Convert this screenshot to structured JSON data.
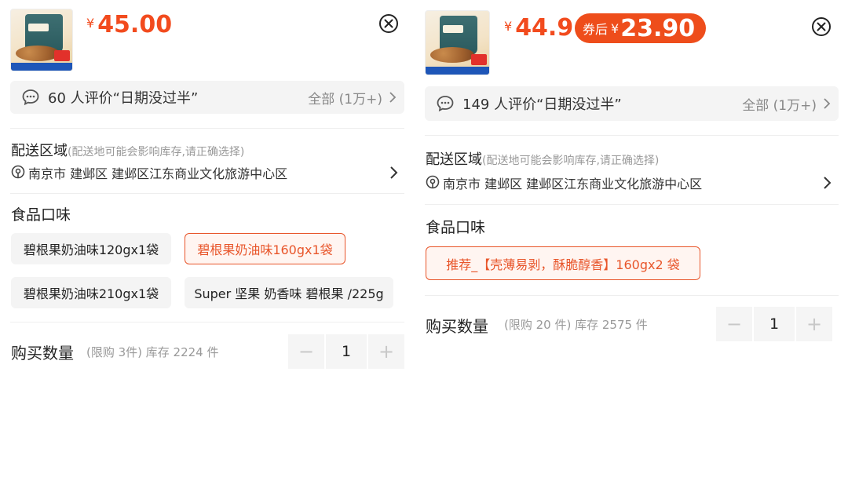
{
  "left": {
    "price": {
      "symbol": "¥",
      "value": "45.00"
    },
    "review": {
      "text": "60 人评价“日期没过半”",
      "all": "全部 (1万+)"
    },
    "delivery": {
      "title": "配送区域",
      "hint": "(配送地可能会影响库存,请正确选择)",
      "address": "南京市 建邺区 建邺区江东商业文化旅游中心区"
    },
    "flavor": {
      "title": "食品口味",
      "options": [
        {
          "label": "碧根果奶油味120gx1袋",
          "selected": false
        },
        {
          "label": "碧根果奶油味160gx1袋",
          "selected": true
        },
        {
          "label": "碧根果奶油味210gx1袋",
          "selected": false
        },
        {
          "label": "Super 坚果 奶香味 碧根果 /225g",
          "selected": false
        }
      ]
    },
    "quantity": {
      "label": "购买数量",
      "info": "(限购 3件) 库存 2224 件",
      "value": "1",
      "minus": "−",
      "plus": "+"
    }
  },
  "right": {
    "price": {
      "symbol": "¥",
      "value": "44.9"
    },
    "coupon": {
      "label": "券后",
      "symbol": "¥",
      "value": "23.90"
    },
    "review": {
      "text": "149 人评价“日期没过半”",
      "all": "全部 (1万+)"
    },
    "delivery": {
      "title": "配送区域",
      "hint": "(配送地可能会影响库存,请正确选择)",
      "address": "南京市 建邺区 建邺区江东商业文化旅游中心区"
    },
    "flavor": {
      "title": "食品口味",
      "options": [
        {
          "label": "推荐_【壳薄易剥，酥脆醇香】160gx2 袋",
          "selected": true
        }
      ]
    },
    "quantity": {
      "label": "购买数量",
      "info": "(限购 20 件) 库存 2575 件",
      "value": "1",
      "minus": "−",
      "plus": "+"
    }
  },
  "colors": {
    "accent": "#f24b1e",
    "coupon_bg": "#ee4d1b",
    "selected_border": "#e8552a"
  }
}
